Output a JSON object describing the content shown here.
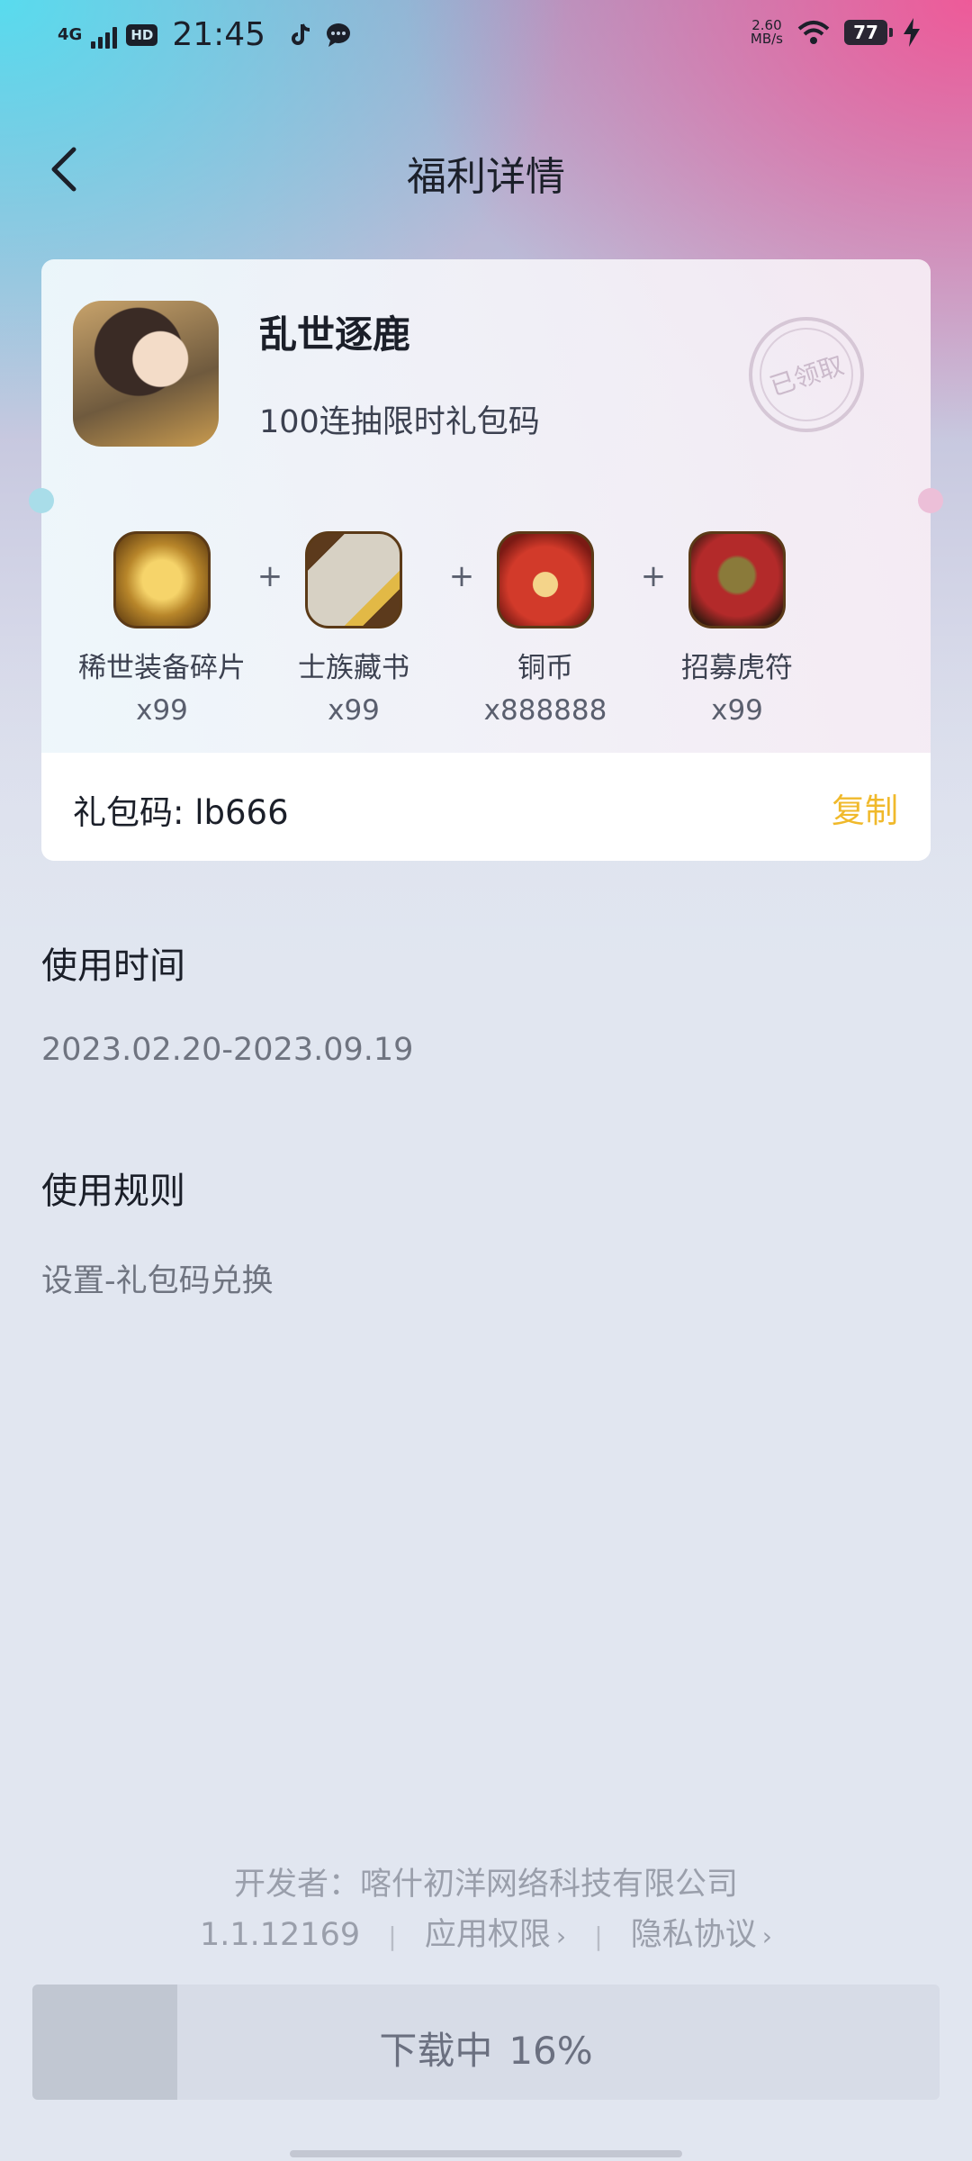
{
  "status_bar": {
    "network": "4G",
    "hd_badge": "HD",
    "time": "21:45",
    "speed_value": "2.60",
    "speed_unit": "MB/s",
    "battery": "77"
  },
  "header": {
    "title": "福利详情"
  },
  "gift": {
    "game_name": "乱世逐鹿",
    "subtitle": "100连抽限时礼包码",
    "stamp_text": "已领取",
    "rewards": [
      {
        "name": "稀世装备碎片",
        "qty": "x99",
        "icon": "equipment-shard-icon"
      },
      {
        "name": "士族藏书",
        "qty": "x99",
        "icon": "scroll-book-icon"
      },
      {
        "name": "铜币",
        "qty": "x888888",
        "icon": "copper-coin-bag-icon"
      },
      {
        "name": "招募虎符",
        "qty": "x99",
        "icon": "recruit-tiger-token-icon"
      }
    ],
    "plus_sign": "+",
    "code_label": "礼包码: lb666",
    "copy_label": "复制"
  },
  "usage_time": {
    "title": "使用时间",
    "value": "2023.02.20-2023.09.19"
  },
  "usage_rules": {
    "title": "使用规则",
    "value": "设置-礼包码兑换"
  },
  "footer": {
    "developer": "开发者：喀什初洋网络科技有限公司",
    "version": "1.1.12169",
    "permissions_label": "应用权限",
    "privacy_label": "隐私协议",
    "separator": "|",
    "chevron": "›"
  },
  "download": {
    "label": "下载中",
    "percent_text": "16%",
    "progress": 0.16
  },
  "colors": {
    "accent": "#f0b92b",
    "download_fill": "#c1c7d2",
    "download_bg": "#d7dce7"
  }
}
